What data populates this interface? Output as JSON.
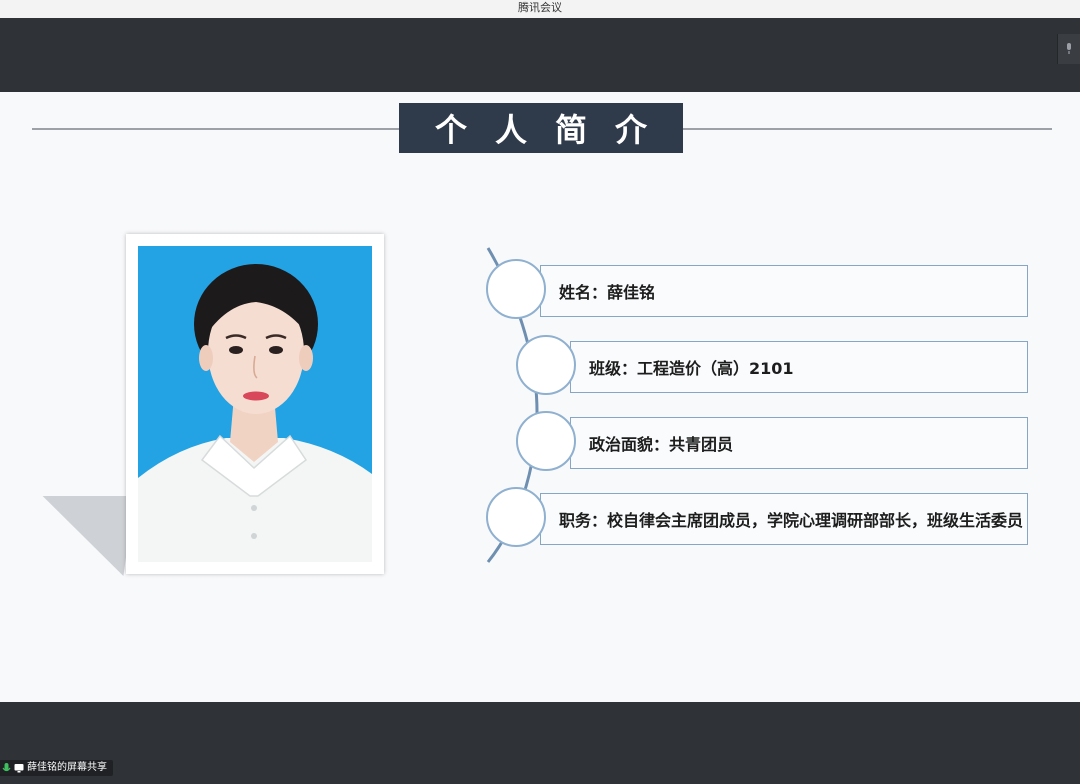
{
  "window": {
    "title": "腾讯会议"
  },
  "slide": {
    "title": "个人简介",
    "info": [
      {
        "label": "姓名",
        "value": "薛佳铭"
      },
      {
        "label": "班级",
        "value": "工程造价（高）2101"
      },
      {
        "label": "政治面貌",
        "value": "共青团员"
      },
      {
        "label": "职务",
        "value": "校自律会主席团成员，学院心理调研部部长，班级生活委员"
      }
    ],
    "separator": "："
  },
  "share": {
    "label": "薛佳铭的屏幕共享"
  },
  "icons": {
    "mic": "microphone-icon",
    "screen": "screen-share-icon"
  },
  "colors": {
    "title_bg": "#2f3a4a",
    "photo_bg": "#23a3e3",
    "accent": "#87a6c4",
    "share_mic": "#3fbf5f"
  }
}
